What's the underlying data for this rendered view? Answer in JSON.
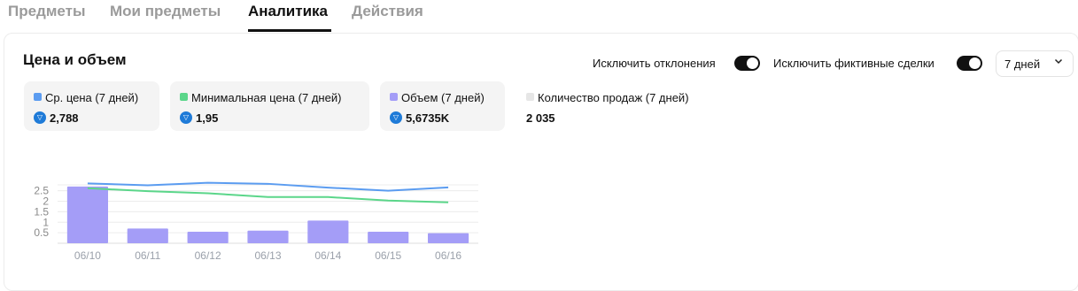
{
  "tabs": [
    {
      "label": "Предметы",
      "active": false
    },
    {
      "label": "Мои предметы",
      "active": false
    },
    {
      "label": "Аналитика",
      "active": true
    },
    {
      "label": "Действия",
      "active": false
    }
  ],
  "section": {
    "title": "Цена и объем"
  },
  "toggles": {
    "exclude_outliers": {
      "label": "Исключить отклонения",
      "on": true
    },
    "exclude_wash": {
      "label": "Исключить фиктивные сделки",
      "on": true
    }
  },
  "period_select": {
    "value": "7 дней"
  },
  "stats": [
    {
      "label": "Ср. цена (7 дней)",
      "value": "2,788",
      "color": "#5b9cf0"
    },
    {
      "label": "Минимальная цена (7 дней)",
      "value": "1,95",
      "color": "#5bd68a"
    },
    {
      "label": "Объем (7 дней)",
      "value": "5,6735K",
      "color": "#a49df7"
    },
    {
      "label": "Количество продаж (7 дней)",
      "value": "2 035",
      "color": "#e6e6e6"
    }
  ],
  "chart_data": {
    "type": "bar",
    "categories": [
      "06/10",
      "06/11",
      "06/12",
      "06/13",
      "06/14",
      "06/15",
      "06/16"
    ],
    "y_ticks": [
      "0.5",
      "1",
      "1.5",
      "2",
      "2.5"
    ],
    "ylim": [
      0,
      2.78
    ],
    "series": [
      {
        "name": "Объем (7 дней)",
        "kind": "bar",
        "color": "#a49df7",
        "values": [
          2.7,
          0.7,
          0.55,
          0.6,
          1.08,
          0.55,
          0.48
        ]
      },
      {
        "name": "Ср. цена (7 дней)",
        "kind": "line",
        "color": "#5b9cf0",
        "values": [
          2.85,
          2.76,
          2.88,
          2.83,
          2.65,
          2.5,
          2.66
        ]
      },
      {
        "name": "Минимальная цена (7 дней)",
        "kind": "line",
        "color": "#5bd68a",
        "values": [
          2.62,
          2.48,
          2.38,
          2.2,
          2.2,
          2.03,
          1.95
        ]
      }
    ],
    "grid": true
  },
  "icons": {
    "currency": "diamond-coin-icon",
    "chevron": "chevron-down-icon"
  }
}
